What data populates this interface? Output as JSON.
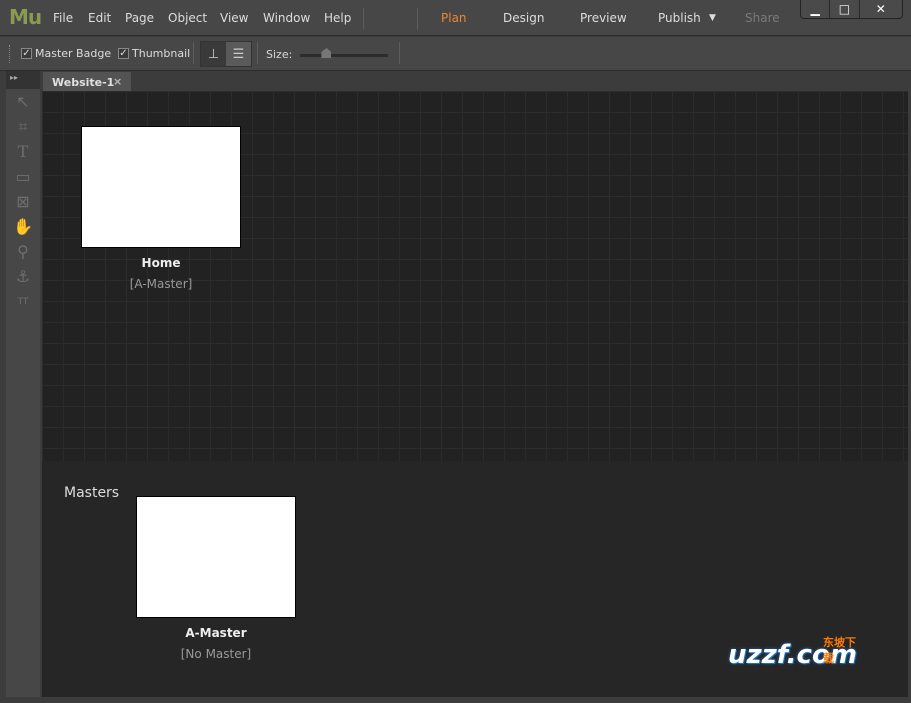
{
  "app": {
    "logo": "Mu"
  },
  "menu": [
    "File",
    "Edit",
    "Page",
    "Object",
    "View",
    "Window",
    "Help"
  ],
  "modes": {
    "plan": "Plan",
    "design": "Design",
    "preview": "Preview",
    "publish": "Publish",
    "share": "Share",
    "active_color": "#e8892f"
  },
  "window_controls": {
    "minimize": "▁",
    "maximize": "□",
    "close": "✕"
  },
  "toolbar": {
    "master_badge": "Master Badge",
    "master_badge_checked": true,
    "thumbnail": "Thumbnail",
    "thumbnail_checked": true,
    "size_label": "Size:",
    "size_value": 0.3
  },
  "tabs": [
    {
      "label": "Website-1",
      "close": "×"
    }
  ],
  "pages": [
    {
      "name": "Home",
      "master": "[A-Master]"
    }
  ],
  "masters": {
    "label": "Masters",
    "items": [
      {
        "name": "A-Master",
        "master": "[No Master]"
      }
    ]
  },
  "watermark": {
    "text": "uzzf.com",
    "subtitle": "东坡下载"
  }
}
